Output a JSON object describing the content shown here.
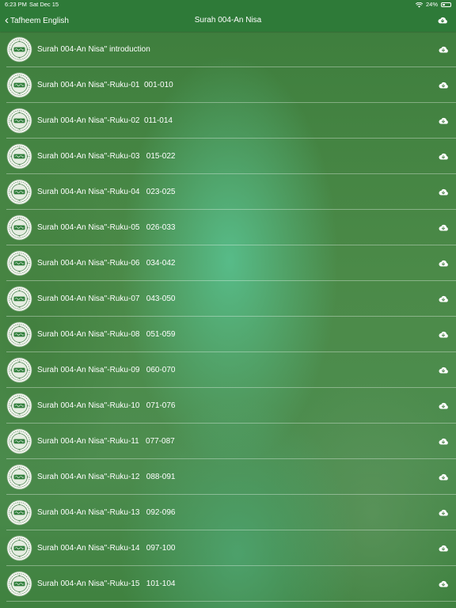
{
  "status_bar": {
    "time": "6:23 PM",
    "date": "Sat Dec 15",
    "battery": "24%"
  },
  "nav": {
    "back_label": "Tafheem English",
    "title": "Surah 004-An Nisa"
  },
  "items": [
    {
      "label": "Surah 004-An Nisa'' introduction"
    },
    {
      "label": "Surah 004-An Nisa''-Ruku-01  001-010"
    },
    {
      "label": "Surah 004-An Nisa''-Ruku-02  011-014"
    },
    {
      "label": "Surah 004-An Nisa''-Ruku-03   015-022"
    },
    {
      "label": "Surah 004-An Nisa''-Ruku-04   023-025"
    },
    {
      "label": "Surah 004-An Nisa''-Ruku-05   026-033"
    },
    {
      "label": "Surah 004-An Nisa''-Ruku-06   034-042"
    },
    {
      "label": "Surah 004-An Nisa''-Ruku-07   043-050"
    },
    {
      "label": "Surah 004-An Nisa''-Ruku-08   051-059"
    },
    {
      "label": "Surah 004-An Nisa''-Ruku-09   060-070"
    },
    {
      "label": "Surah 004-An Nisa''-Ruku-10   071-076"
    },
    {
      "label": "Surah 004-An Nisa''-Ruku-11   077-087"
    },
    {
      "label": "Surah 004-An Nisa''-Ruku-12   088-091"
    },
    {
      "label": "Surah 004-An Nisa''-Ruku-13   092-096"
    },
    {
      "label": "Surah 004-An Nisa''-Ruku-14   097-100"
    },
    {
      "label": "Surah 004-An Nisa''-Ruku-15   101-104"
    }
  ],
  "icons": {
    "row_thumbnail": "surah-medallion-icon",
    "row_action": "cloud-download-icon",
    "nav_action": "cloud-download-icon"
  },
  "colors": {
    "nav_bar": "#2e7a38",
    "background": "#4b8a48",
    "text": "#ffffff"
  }
}
